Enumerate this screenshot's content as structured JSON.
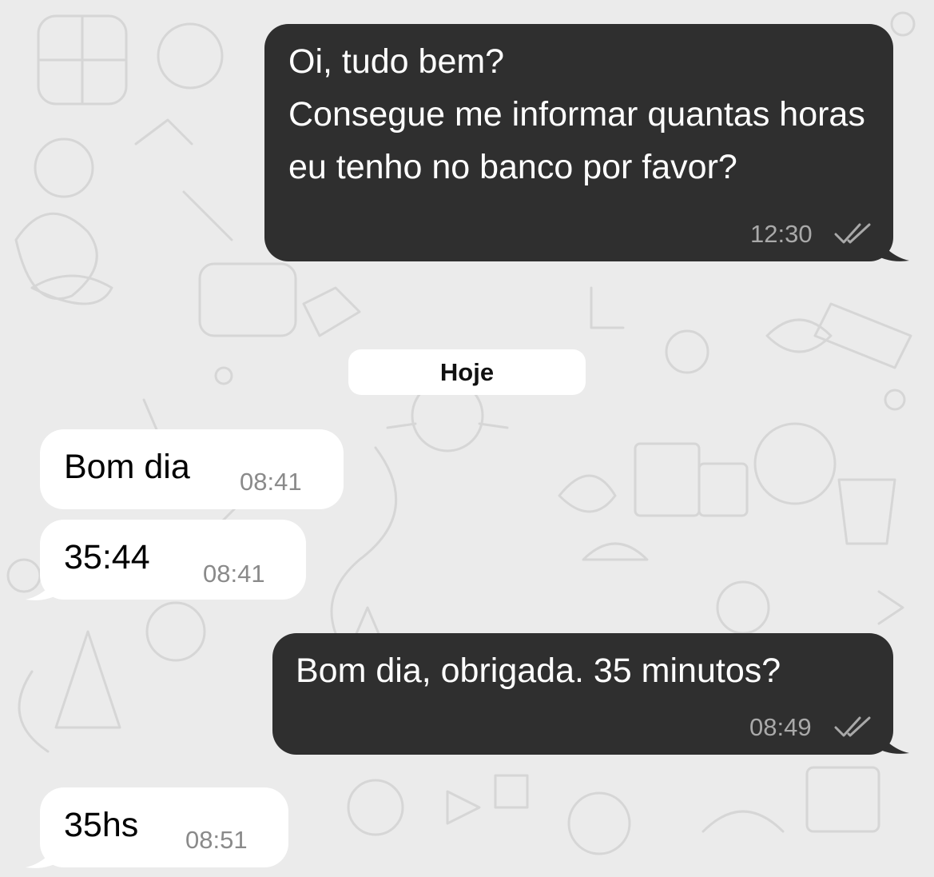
{
  "messages": [
    {
      "direction": "outgoing",
      "text": "Oi, tudo bem?\nConsegue me informar quantas horas eu tenho no banco por favor?",
      "time": "12:30",
      "status_icon": "double-check-icon"
    },
    {
      "direction": "incoming",
      "text": "Bom dia",
      "time": "08:41"
    },
    {
      "direction": "incoming",
      "text": "35:44",
      "time": "08:41"
    },
    {
      "direction": "outgoing",
      "text": "Bom dia, obrigada. 35 minutos?",
      "time": "08:49",
      "status_icon": "double-check-icon"
    },
    {
      "direction": "incoming",
      "text": "35hs",
      "time": "08:51"
    }
  ],
  "date_separator": "Hoje",
  "colors": {
    "background": "#ebebeb",
    "outgoing_bubble": "#2f2f2f",
    "incoming_bubble": "#ffffff",
    "timestamp_outgoing": "#a9a9a9",
    "timestamp_incoming": "#8a8a8a"
  }
}
